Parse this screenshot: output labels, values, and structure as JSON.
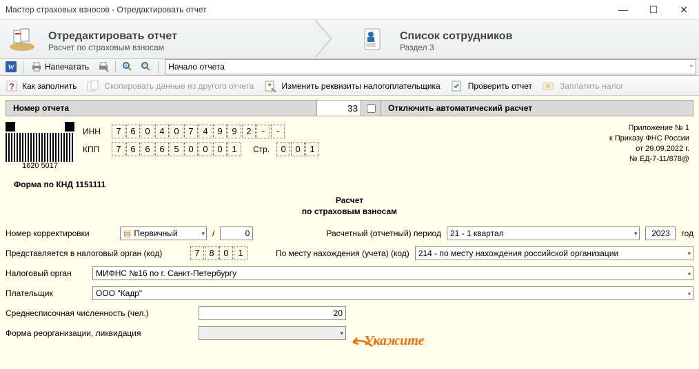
{
  "window": {
    "title": "Мастер страховых взносов - Отредактировать отчет"
  },
  "wizard": {
    "step1": {
      "title": "Отредактировать отчет",
      "subtitle": "Расчет по страховым взносам"
    },
    "step2": {
      "title": "Список сотрудников",
      "subtitle": "Раздел 3"
    }
  },
  "toolbar": {
    "print": "Напечатать",
    "section": "Начало отчета"
  },
  "actions": {
    "how_to": "Как заполнить",
    "copy": "Скопировать данные из другого отчета",
    "edit_req": "Изменить реквизиты налогоплательщика",
    "check": "Проверить отчет",
    "pay": "Заплатить налог"
  },
  "header_row": {
    "num_label": "Номер отчета",
    "num_value": "33",
    "disable_autocalc": "Отключить автоматический расчет"
  },
  "ids": {
    "inn_label": "ИНН",
    "inn": [
      "7",
      "6",
      "0",
      "4",
      "0",
      "7",
      "4",
      "9",
      "9",
      "2",
      "-",
      "-"
    ],
    "kpp_label": "КПП",
    "kpp": [
      "7",
      "6",
      "6",
      "6",
      "5",
      "0",
      "0",
      "0",
      "1"
    ],
    "page_label": "Стр.",
    "page": [
      "0",
      "0",
      "1"
    ],
    "barcode_num": "1620 5017"
  },
  "app_info": {
    "l1": "Приложение № 1",
    "l2": "к Приказу ФНС России",
    "l3": "от 29.09.2022 г.",
    "l4": "№ ЕД-7-11/878@"
  },
  "form_code": "Форма по КНД 1151111",
  "doc_title": {
    "l1": "Расчет",
    "l2": "по страховым взносам"
  },
  "fields": {
    "corr_label": "Номер корректировки",
    "corr_type": "Первичный",
    "corr_num": "0",
    "period_label": "Расчетный (отчетный) период",
    "period_value": "21 - 1 квартал",
    "year": "2023",
    "year_label": "год",
    "tax_org_code_label": "Представляется в налоговый орган (код)",
    "tax_org_code": [
      "7",
      "8",
      "0",
      "1"
    ],
    "place_label": "По месту нахождения (учета) (код)",
    "place_value": "214 - по месту нахождения российской организации",
    "tax_org_label": "Налоговый орган",
    "tax_org_value": "МИФНС №16 по г. Санкт-Петербургу",
    "payer_label": "Плательщик",
    "payer_value": "ООО \"Кадр\"",
    "avg_count_label": "Среднесписочная численность (чел.)",
    "avg_count_value": "20",
    "reorg_label": "Форма реорганизации, ликвидация"
  },
  "annotation": "Укажите"
}
